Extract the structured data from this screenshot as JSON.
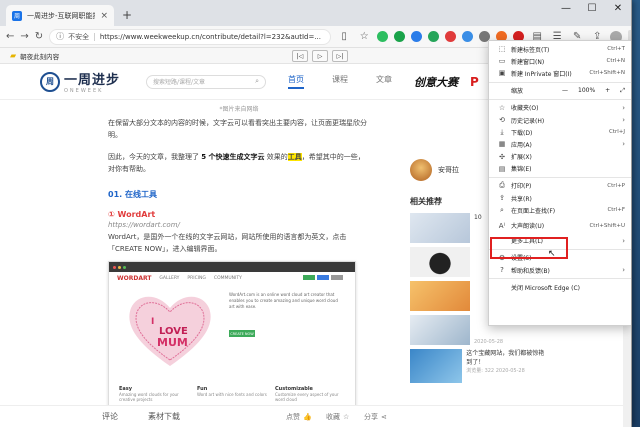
{
  "browser": {
    "tab_title": "一周进步-互联网职能技能入口",
    "tab_close": "×",
    "new_tab": "+",
    "window_controls": [
      "—",
      "☐",
      "✕"
    ],
    "insecure_label": "不安全",
    "url": "https://www.weekweekup.cn/contribute/detail?l=232&autId=...",
    "favorites_label": "朝夜此刻内容"
  },
  "site": {
    "logo_cn": "一周进步",
    "logo_en": "ONEWEEK",
    "logo_mark": "周",
    "search_placeholder": "搜索短路/课程/文章",
    "nav": [
      "首页",
      "课程",
      "文章"
    ],
    "brand_word": "创意大赛",
    "brand_p": "P"
  },
  "article": {
    "caption": "*图片来自网络",
    "para1": "在保留大部分文本的内容的时候，文字云可以看看突出主要内容，让页面更瑞星欣分明。",
    "para2_prefix": "因此，今天的文章，我整理了",
    "para2_bold": "5 个快速生成文字云",
    "para2_mid": "效果的",
    "para2_hl": "工具",
    "para2_suffix": "，希望其中的一些，对你有帮助。",
    "h2": "01. 在线工具",
    "h3": "① WordArt",
    "h3_url": "https://wordart.com/",
    "para3": "WordArt，是国外一个在线的文字云网站，网站所使用的语言都为英文，点击「CREATE NOW」，进入编辑界面。",
    "shot": {
      "brand": "WORDART",
      "nav": [
        "GALLERY",
        "PRICING",
        "COMMUNITY"
      ],
      "text": "WordArt.com is an online word cloud art creator that enables you to create amazing and unique word cloud art with ease.",
      "cta": "CREATE NOW",
      "heart_words": [
        "I",
        "LOVE",
        "MUM"
      ],
      "cols": [
        {
          "title": "Easy",
          "text": "Amazing word clouds for your creative projects"
        },
        {
          "title": "Fun",
          "text": "Word art with nice fonts and colors"
        },
        {
          "title": "Customizable",
          "text": "Customize every aspect of your word cloud"
        }
      ]
    }
  },
  "bottombar": {
    "comment": "评论",
    "download": "素材下载",
    "like": "点赞",
    "fav": "收藏",
    "share": "分享"
  },
  "sidebar": {
    "author": "安哥拉",
    "related_title": "相关推荐",
    "items": [
      {
        "text": "10",
        "meta": ""
      },
      {
        "text": "",
        "meta": ""
      },
      {
        "text": "",
        "meta": ""
      },
      {
        "text": "",
        "meta": "2020-05-28"
      },
      {
        "text": "这个宝藏网站，我们都被惊艳到了！",
        "meta": "浏览量: 322  2020-05-28"
      }
    ]
  },
  "menu": {
    "items": [
      {
        "icon": "⬚",
        "label": "新建标签页(T)",
        "shortcut": "Ctrl+T"
      },
      {
        "icon": "▭",
        "label": "新建窗口(N)",
        "shortcut": "Ctrl+N"
      },
      {
        "icon": "▣",
        "label": "新建 InPrivate 窗口(I)",
        "shortcut": "Ctrl+Shift+N"
      },
      {
        "icon": "",
        "label": "缩放",
        "shortcut": ""
      },
      {
        "icon": "☆",
        "label": "收藏夹(O)",
        "shortcut": ""
      },
      {
        "icon": "⟲",
        "label": "历史记录(H)",
        "shortcut": ""
      },
      {
        "icon": "⤓",
        "label": "下载(D)",
        "shortcut": "Ctrl+J"
      },
      {
        "icon": "▦",
        "label": "应用(A)",
        "shortcut": ""
      },
      {
        "icon": "✣",
        "label": "扩展(X)",
        "shortcut": ""
      },
      {
        "icon": "▤",
        "label": "集锦(E)",
        "shortcut": ""
      },
      {
        "icon": "⎙",
        "label": "打印(P)",
        "shortcut": "Ctrl+P"
      },
      {
        "icon": "⇪",
        "label": "共享(R)",
        "shortcut": ""
      },
      {
        "icon": "⌕",
        "label": "在页面上查找(F)",
        "shortcut": "Ctrl+F"
      },
      {
        "icon": "A⁾",
        "label": "大声朗读(U)",
        "shortcut": "Ctrl+Shift+U"
      },
      {
        "icon": "",
        "label": "更多工具(L)",
        "shortcut": ""
      },
      {
        "icon": "⚙",
        "label": "设置(S)",
        "shortcut": ""
      },
      {
        "icon": "?",
        "label": "帮助和反馈(B)",
        "shortcut": ""
      },
      {
        "icon": "",
        "label": "关闭 Microsoft Edge (C)",
        "shortcut": ""
      }
    ],
    "zoom_minus": "—",
    "zoom_value": "100%",
    "zoom_plus": "+",
    "zoom_full": "⤢",
    "arrow": "›"
  }
}
